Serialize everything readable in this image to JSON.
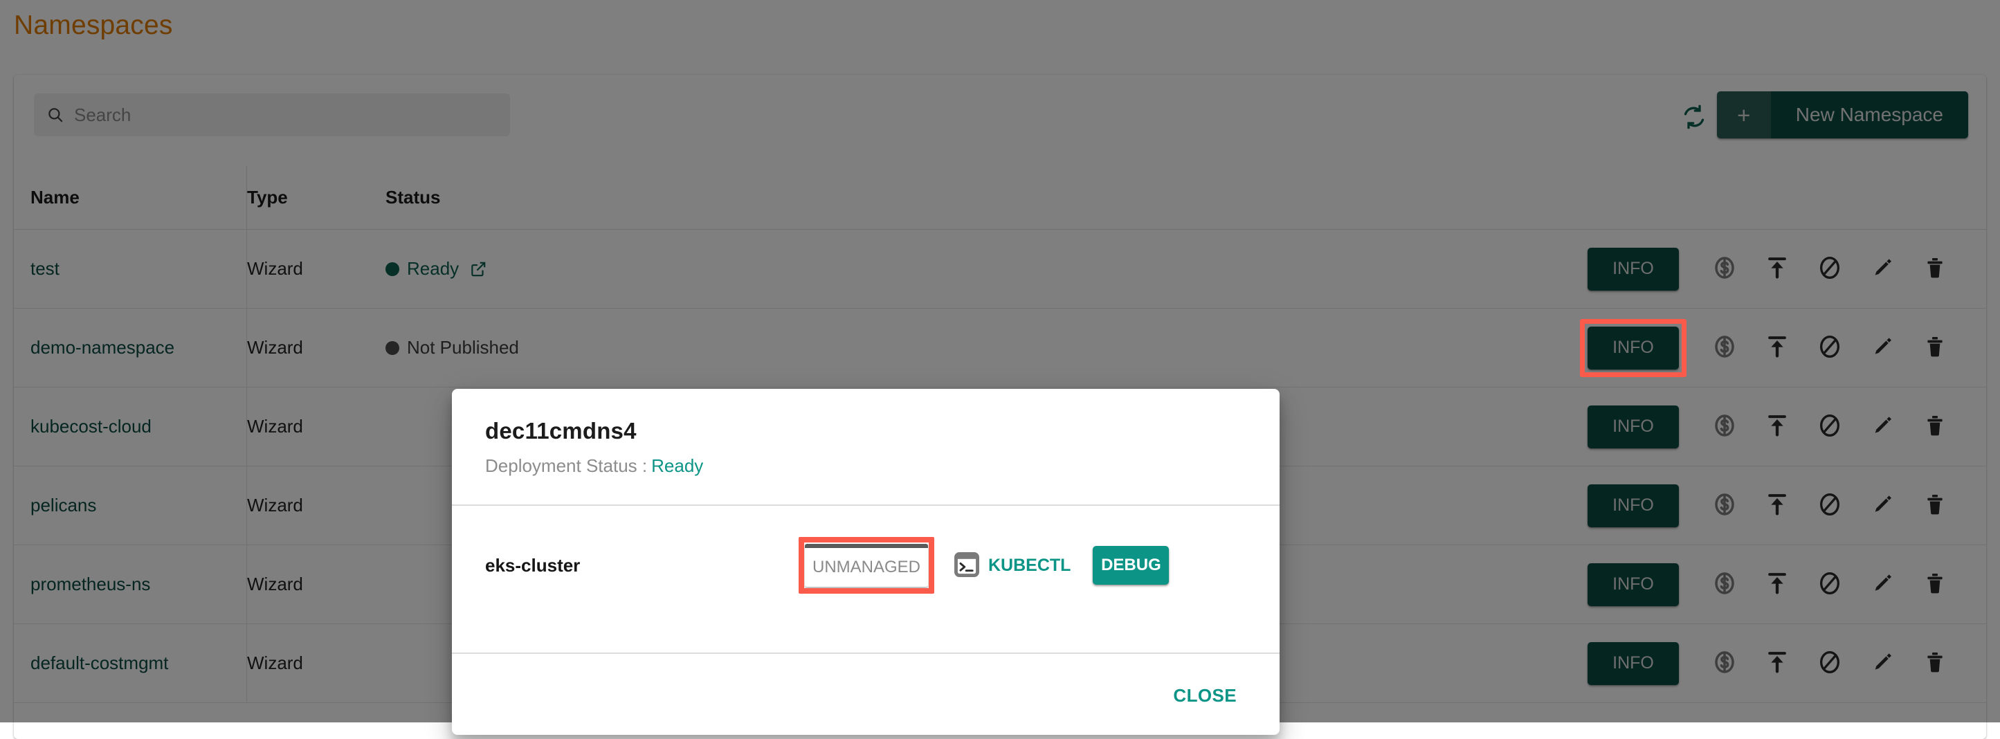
{
  "page": {
    "title": "Namespaces",
    "title_color": "#E07B00"
  },
  "toolbar": {
    "search_placeholder": "Search",
    "search_value": "",
    "search_icon": "search-icon",
    "refresh_icon": "refresh-icon",
    "new_namespace_plus": "+",
    "new_namespace_label": "New Namespace"
  },
  "table": {
    "headers": {
      "name": "Name",
      "type": "Type",
      "status": "Status"
    },
    "rows": [
      {
        "name": "test",
        "type": "Wizard",
        "status": "Ready",
        "status_state": "ready",
        "has_external_link": true,
        "info_label": "INFO",
        "highlighted": false
      },
      {
        "name": "demo-namespace",
        "type": "Wizard",
        "status": "Not Published",
        "status_state": "notpub",
        "has_external_link": false,
        "info_label": "INFO",
        "highlighted": true
      },
      {
        "name": "kubecost-cloud",
        "type": "Wizard",
        "status": "",
        "status_state": "hidden",
        "has_external_link": false,
        "info_label": "INFO",
        "highlighted": false
      },
      {
        "name": "pelicans",
        "type": "Wizard",
        "status": "",
        "status_state": "hidden",
        "has_external_link": false,
        "info_label": "INFO",
        "highlighted": false
      },
      {
        "name": "prometheus-ns",
        "type": "Wizard",
        "status": "",
        "status_state": "hidden",
        "has_external_link": false,
        "info_label": "INFO",
        "highlighted": false
      },
      {
        "name": "default-costmgmt",
        "type": "Wizard",
        "status": "",
        "status_state": "hidden",
        "has_external_link": false,
        "info_label": "INFO",
        "highlighted": false
      }
    ],
    "action_icons": [
      "dollar-cost-icon",
      "publish-upload-icon",
      "disable-ban-icon",
      "edit-pencil-icon",
      "delete-trash-icon"
    ]
  },
  "modal": {
    "title": "dec11cmdns4",
    "status_label": "Deployment Status :",
    "status_value": "Ready",
    "cluster_name": "eks-cluster",
    "unmanaged_label": "UNMANAGED",
    "kubectl_label": "KUBECTL",
    "kubectl_icon": "terminal-icon",
    "debug_label": "DEBUG",
    "close_label": "CLOSE"
  },
  "colors": {
    "brand_dark_green": "#0B4A42",
    "teal": "#0C9586",
    "highlight_red": "#FB5B4B",
    "title_orange": "#E07B00"
  }
}
